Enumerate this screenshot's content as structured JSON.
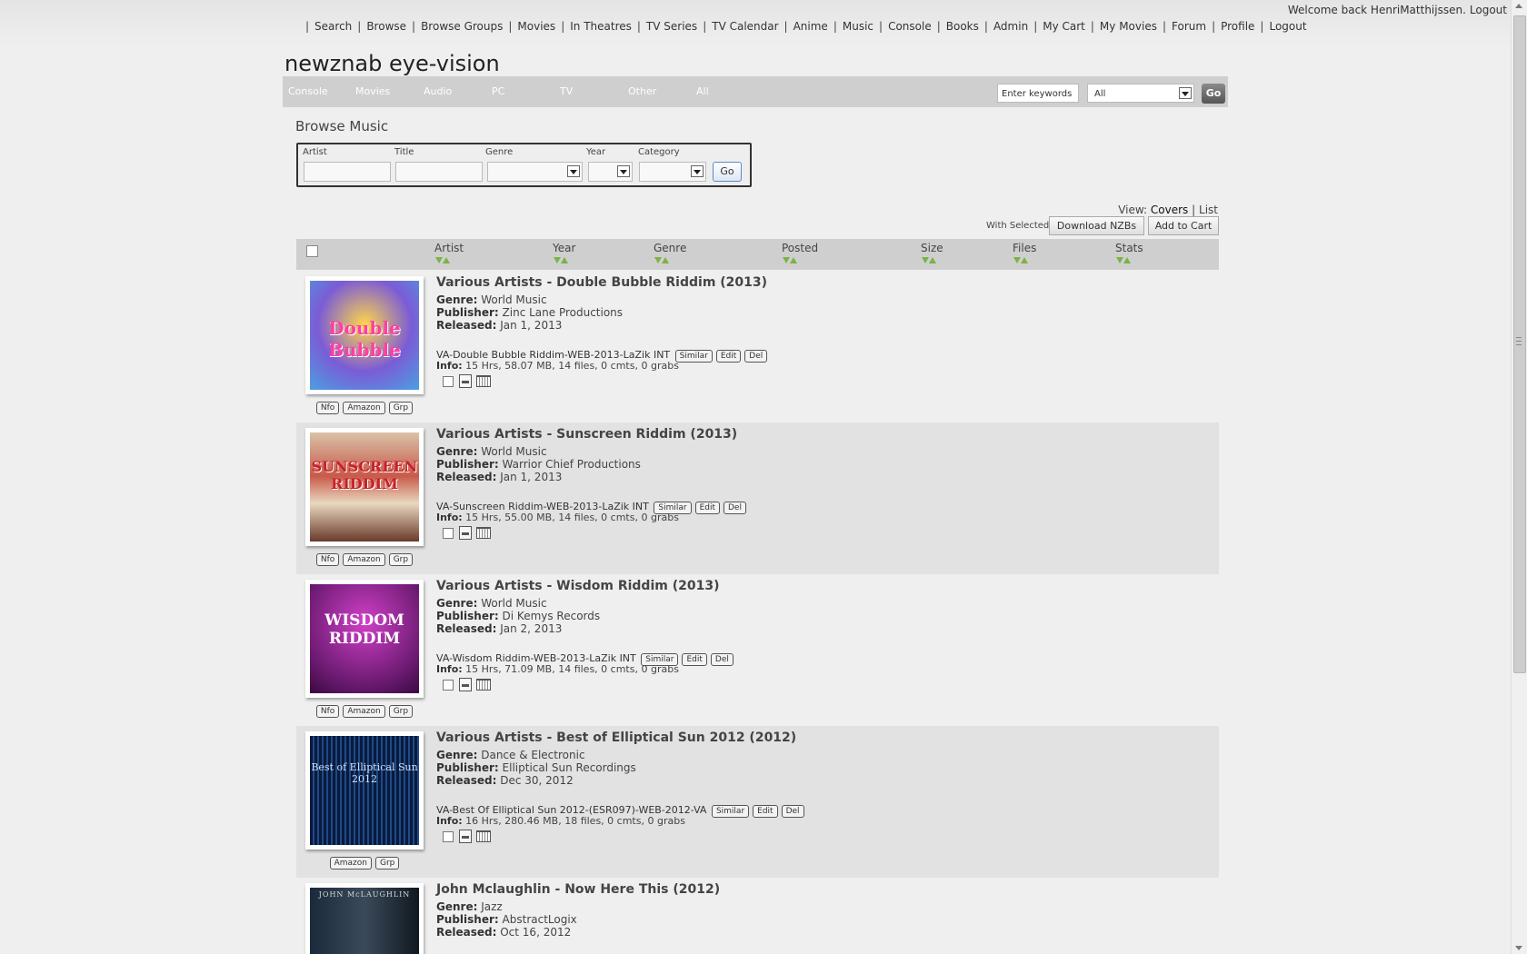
{
  "header": {
    "welcome_text": "Welcome back HenriMatthijssen.",
    "logout_link": "Logout",
    "nav": [
      "Search",
      "Browse",
      "Browse Groups",
      "Movies",
      "In Theatres",
      "TV Series",
      "TV Calendar",
      "Anime",
      "Music",
      "Console",
      "Books",
      "Admin",
      "My Cart",
      "My Movies",
      "Forum",
      "Profile",
      "Logout"
    ]
  },
  "site_title": "newznab eye-vision",
  "category_bar": {
    "items": [
      "Console",
      "Movies",
      "Audio",
      "PC",
      "TV",
      "Other",
      "All"
    ],
    "search_placeholder": "Enter keywords",
    "search_category": "All",
    "go_label": "Go"
  },
  "page_heading": "Browse Music",
  "filters": {
    "artist_label": "Artist",
    "title_label": "Title",
    "genre_label": "Genre",
    "year_label": "Year",
    "category_label": "Category",
    "go_label": "Go"
  },
  "view": {
    "label": "View:",
    "covers": "Covers",
    "separator": "|",
    "list": "List"
  },
  "with_selected": {
    "label": "With Selected:",
    "download": "Download NZBs",
    "add_to_cart": "Add to Cart"
  },
  "table_columns": [
    "Artist",
    "Year",
    "Genre",
    "Posted",
    "Size",
    "Files",
    "Stats"
  ],
  "labels": {
    "genre": "Genre:",
    "publisher": "Publisher:",
    "released": "Released:",
    "info": "Info:",
    "similar": "Similar",
    "edit": "Edit",
    "del": "Del",
    "nfo": "Nfo",
    "amazon": "Amazon",
    "grp": "Grp"
  },
  "releases": [
    {
      "title": "Various Artists - Double Bubble Riddim (2013)",
      "genre": "World Music",
      "publisher": "Zinc Lane Productions",
      "released": "Jan 1, 2013",
      "release_name": "VA-Double Bubble Riddim-WEB-2013-LaZik INT",
      "info": "15 Hrs, 58.07 MB, 14 files, 0 cmts, 0 grabs",
      "cover_text": "Double Bubble",
      "has_nfo": true
    },
    {
      "title": "Various Artists - Sunscreen Riddim (2013)",
      "genre": "World Music",
      "publisher": "Warrior Chief Productions",
      "released": "Jan 1, 2013",
      "release_name": "VA-Sunscreen Riddim-WEB-2013-LaZik INT",
      "info": "15 Hrs, 55.00 MB, 14 files, 0 cmts, 0 grabs",
      "cover_text": "SUNSCREEN RIDDIM",
      "has_nfo": true
    },
    {
      "title": "Various Artists - Wisdom Riddim (2013)",
      "genre": "World Music",
      "publisher": "Di Kemys Records",
      "released": "Jan 2, 2013",
      "release_name": "VA-Wisdom Riddim-WEB-2013-LaZik INT",
      "info": "15 Hrs, 71.09 MB, 14 files, 0 cmts, 0 grabs",
      "cover_text": "WISDOM RIDDIM",
      "has_nfo": true
    },
    {
      "title": "Various Artists - Best of Elliptical Sun 2012 (2012)",
      "genre": "Dance & Electronic",
      "publisher": "Elliptical Sun Recordings",
      "released": "Dec 30, 2012",
      "release_name": "VA-Best Of Elliptical Sun 2012-(ESR097)-WEB-2012-VA",
      "info": "16 Hrs, 280.46 MB, 18 files, 0 cmts, 0 grabs",
      "cover_text": "Best of Elliptical Sun 2012",
      "has_nfo": false
    },
    {
      "title": "John Mclaughlin - Now Here This (2012)",
      "genre": "Jazz",
      "publisher": "AbstractLogix",
      "released": "Oct 16, 2012",
      "cover_text": "JOHN McLAUGHLIN"
    }
  ]
}
